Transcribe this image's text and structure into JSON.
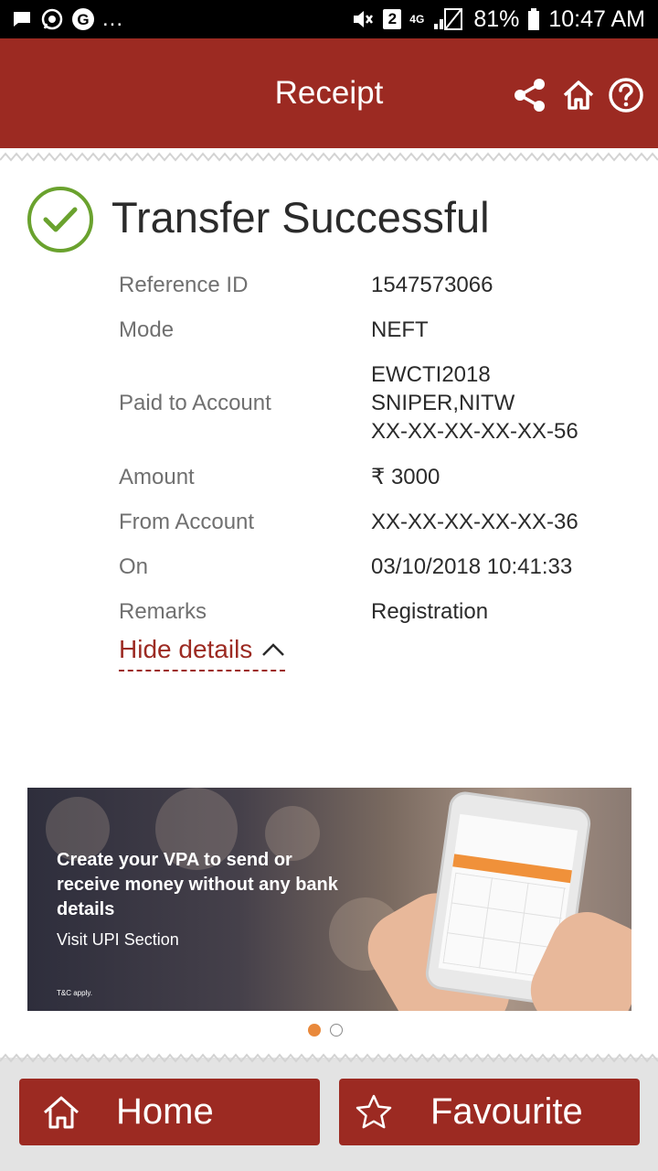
{
  "status_bar": {
    "left_icons": [
      "message-icon",
      "whatsapp-icon",
      "google-icon"
    ],
    "more": "...",
    "sim_badge": "2",
    "network": "4G",
    "battery": "81%",
    "time": "10:47 AM"
  },
  "header": {
    "title": "Receipt",
    "icons": [
      "share-icon",
      "home-icon",
      "help-icon"
    ]
  },
  "result": {
    "title": "Transfer Successful"
  },
  "details": [
    {
      "label": "Reference ID",
      "value": "1547573066"
    },
    {
      "label": "Mode",
      "value": "NEFT"
    },
    {
      "label": "Paid to Account",
      "value": "EWCTI2018\nSNIPER,NITW\nXX-XX-XX-XX-XX-56"
    },
    {
      "label": "Amount",
      "value": "₹ 3000"
    },
    {
      "label": "From Account",
      "value": "XX-XX-XX-XX-XX-36"
    },
    {
      "label": "On",
      "value": "03/10/2018 10:41:33"
    },
    {
      "label": "Remarks",
      "value": "Registration"
    }
  ],
  "hide_details": "Hide details",
  "banner": {
    "headline": "Create your VPA to send or receive money without any bank details",
    "subtext": "Visit UPI Section",
    "terms": "T&C apply.",
    "page_index": 1,
    "page_count": 2
  },
  "footer": {
    "home_label": "Home",
    "favourite_label": "Favourite"
  },
  "colors": {
    "brand": "#9c2a22",
    "success": "#6aa22e",
    "dot_active": "#e9893b"
  }
}
